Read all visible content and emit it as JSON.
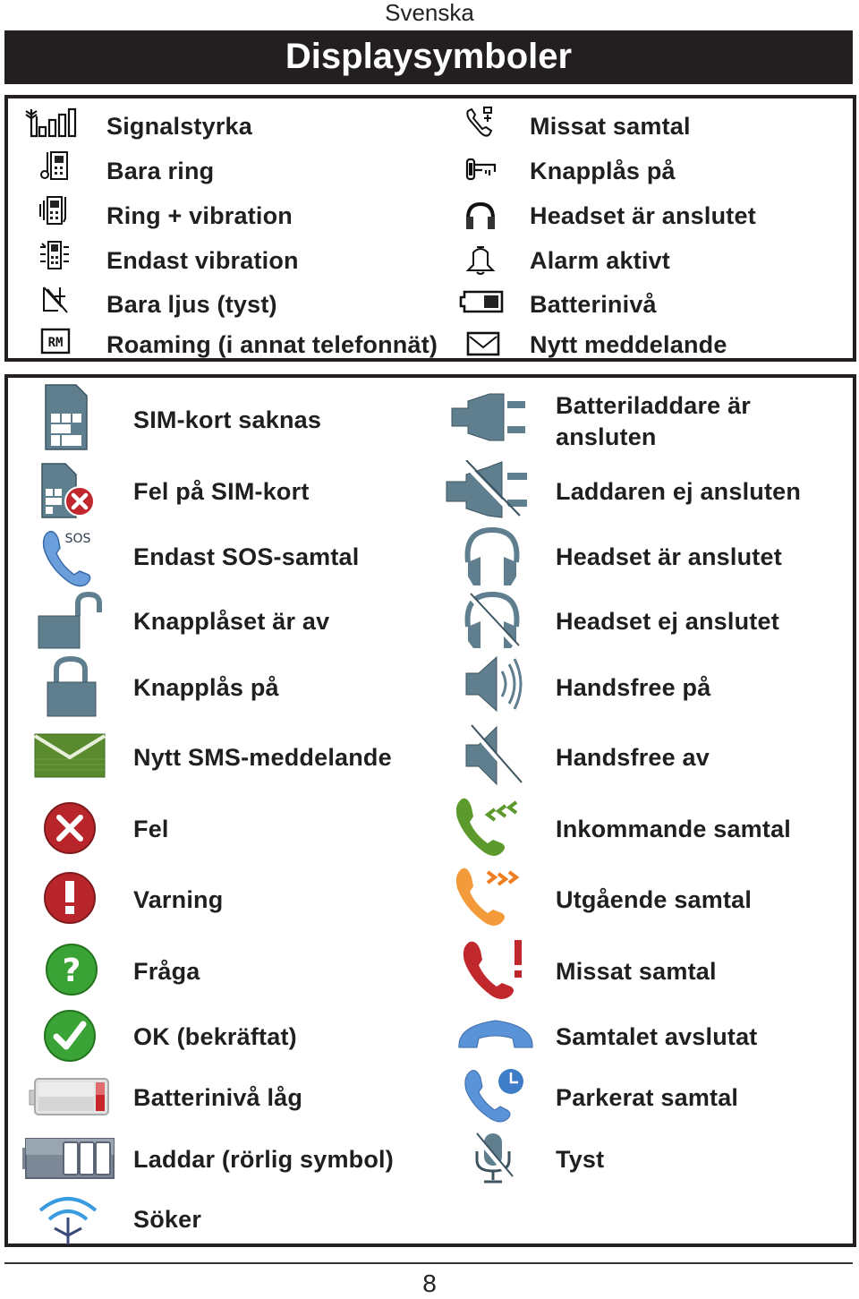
{
  "header": {
    "language": "Svenska",
    "title": "Displaysymboler"
  },
  "display_symbols": {
    "left": [
      {
        "icon": "signal-strength-icon",
        "label": "Signalstyrka"
      },
      {
        "icon": "ring-only-icon",
        "label": "Bara ring"
      },
      {
        "icon": "ring-vibration-icon",
        "label": "Ring + vibration"
      },
      {
        "icon": "vibration-only-icon",
        "label": "Endast vibration"
      },
      {
        "icon": "light-only-silent-icon",
        "label": "Bara ljus (tyst)"
      },
      {
        "icon": "roaming-icon",
        "label": "Roaming (i annat telefonnät)"
      }
    ],
    "right": [
      {
        "icon": "missed-call-icon",
        "label": "Missat samtal"
      },
      {
        "icon": "key-lock-icon",
        "label": "Knapplås på"
      },
      {
        "icon": "headset-icon",
        "label": "Headset är anslutet"
      },
      {
        "icon": "alarm-bell-icon",
        "label": "Alarm aktivt"
      },
      {
        "icon": "battery-level-icon",
        "label": "Batterinivå"
      },
      {
        "icon": "envelope-icon",
        "label": "Nytt meddelande"
      }
    ]
  },
  "graphic_symbols": {
    "left": [
      {
        "icon": "sim-card-icon",
        "label": "SIM-kort saknas"
      },
      {
        "icon": "sim-card-error-icon",
        "label": "Fel på SIM-kort"
      },
      {
        "icon": "sos-phone-icon",
        "label": "Endast SOS-samtal"
      },
      {
        "icon": "padlock-open-icon",
        "label": "Knapplåset är av"
      },
      {
        "icon": "padlock-closed-icon",
        "label": "Knapplås på"
      },
      {
        "icon": "sms-envelope-icon",
        "label": "Nytt SMS-meddelande"
      },
      {
        "icon": "error-x-icon",
        "label": "Fel"
      },
      {
        "icon": "warning-exclamation-icon",
        "label": "Varning"
      },
      {
        "icon": "question-icon",
        "label": "Fråga"
      },
      {
        "icon": "ok-check-icon",
        "label": "OK (bekräftat)"
      },
      {
        "icon": "battery-low-icon",
        "label": "Batterinivå låg"
      },
      {
        "icon": "battery-charging-icon",
        "label": "Laddar (rörlig symbol)"
      },
      {
        "icon": "searching-antenna-icon",
        "label": "Söker"
      }
    ],
    "right": [
      {
        "icon": "charger-plug-icon",
        "label": "Batteriladdare är ansluten"
      },
      {
        "icon": "charger-unplugged-icon",
        "label": "Laddaren ej ansluten"
      },
      {
        "icon": "headset-connected-icon",
        "label": "Headset är anslutet"
      },
      {
        "icon": "headset-disconnected-icon",
        "label": "Headset ej anslutet"
      },
      {
        "icon": "speaker-on-icon",
        "label": "Handsfree på"
      },
      {
        "icon": "speaker-off-icon",
        "label": "Handsfree av"
      },
      {
        "icon": "incoming-call-icon",
        "label": "Inkommande samtal"
      },
      {
        "icon": "outgoing-call-icon",
        "label": "Utgående samtal"
      },
      {
        "icon": "missed-call-red-icon",
        "label": "Missat samtal"
      },
      {
        "icon": "call-ended-icon",
        "label": "Samtalet avslutat"
      },
      {
        "icon": "parked-call-icon",
        "label": "Parkerat samtal"
      },
      {
        "icon": "mute-mic-icon",
        "label": "Tyst"
      }
    ]
  },
  "colors": {
    "titlebar": "#231f20",
    "icon_slate": "#5f7f8f",
    "sms_green": "#5a8a2e",
    "error_red": "#b8262c",
    "ok_green": "#3aa335",
    "incoming_green": "#5d9a2e",
    "outgoing_orange": "#f39a3a",
    "missed_red": "#c0282e",
    "call_blue": "#5b93d8",
    "search_blue": "#2f8fd0"
  },
  "footer": {
    "page_number": "8"
  }
}
